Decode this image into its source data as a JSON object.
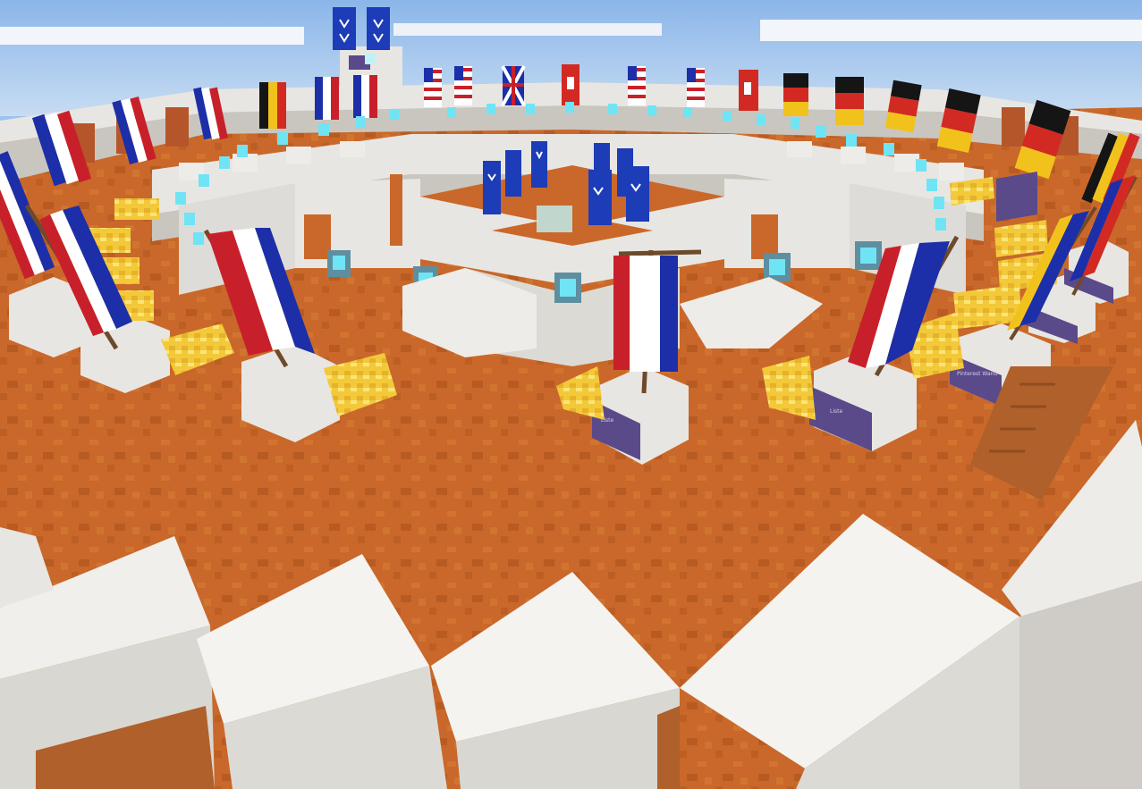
{
  "scene": {
    "title": "",
    "banner_flags": [
      {
        "kind": "france",
        "colors": [
          "#c8202a",
          "#ffffff",
          "#1c2fa8"
        ]
      },
      {
        "kind": "belgium",
        "colors": [
          "#151515",
          "#f2c21c",
          "#d22a22"
        ]
      },
      {
        "kind": "usa",
        "colors": [
          "#c8202a",
          "#ffffff",
          "#1c2fa8"
        ]
      },
      {
        "kind": "uk",
        "colors": [
          "#1c2fa8",
          "#ffffff",
          "#c8202a"
        ]
      },
      {
        "kind": "red-banner",
        "colors": [
          "#d22a22",
          "#ffffff"
        ]
      },
      {
        "kind": "germany",
        "colors": [
          "#151515",
          "#d22a22",
          "#f2c21c"
        ]
      },
      {
        "kind": "blue-emblem",
        "colors": [
          "#1c3cb8",
          "#ffffff"
        ]
      }
    ],
    "block_colors": {
      "quartz": "#e8e6e2",
      "quartz_shade": "#c9c6c0",
      "terracotta": "#c9682a",
      "terracotta_dark": "#a2521f",
      "gold": "#f3c93a",
      "obsidian_sign": "#5a4a8a",
      "lantern_glow": "#6fe4f5",
      "sky": "#9cc3ee"
    },
    "icons": [
      "lantern-icon",
      "banner-flag-icon",
      "gold-block-icon",
      "sign-plaque-icon"
    ]
  }
}
